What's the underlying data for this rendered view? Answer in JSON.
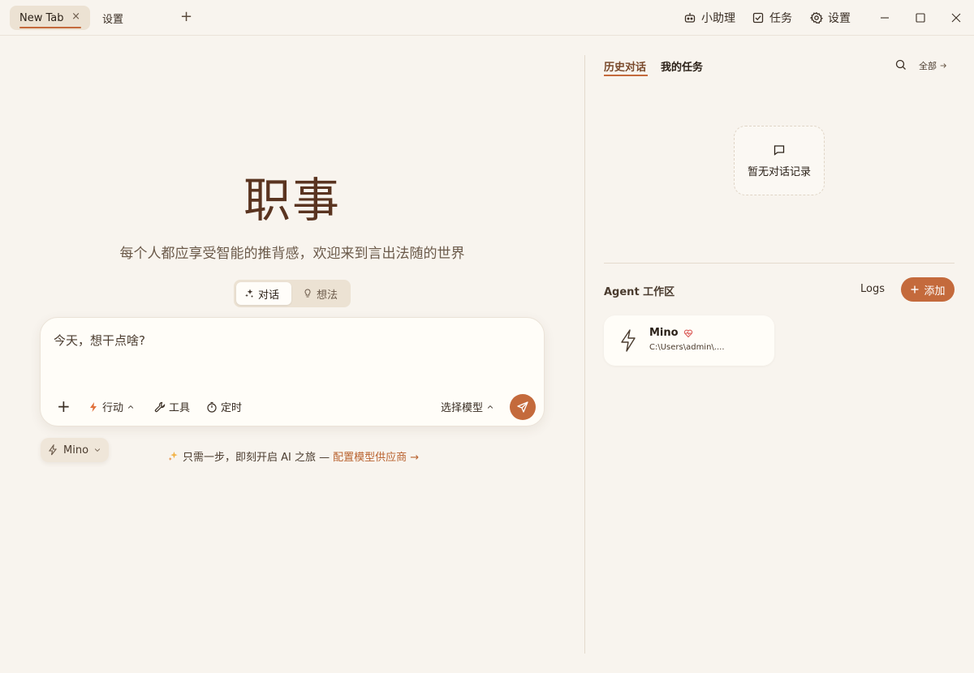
{
  "tabs": [
    {
      "label": "New Tab",
      "active": true,
      "close": "×"
    },
    {
      "label": "设置",
      "active": false
    }
  ],
  "new_tab_symbol": "+",
  "titlebar_actions": [
    {
      "label": "小助理",
      "icon": "robot-icon"
    },
    {
      "label": "任务",
      "icon": "checkbox-icon"
    },
    {
      "label": "设置",
      "icon": "gear-icon"
    }
  ],
  "window_controls": [
    "minimize",
    "maximize",
    "close"
  ],
  "main": {
    "brand": "职事",
    "tagline": "每个人都应享受智能的推背感，欢迎来到言出法随的世界",
    "modes": [
      {
        "label": "对话",
        "icon": "sparkle-icon",
        "selected": true
      },
      {
        "label": "想法",
        "icon": "lightbulb-icon",
        "selected": false
      }
    ],
    "composer": {
      "placeholder": "今天，想干点啥?",
      "add_symbol": "+",
      "action_label": "行动",
      "tools_label": "工具",
      "schedule_label": "定时",
      "model_label": "选择模型"
    },
    "agent_pill": {
      "label": "Mino"
    },
    "setup_hint": {
      "text": "只需一步，即刻开启 AI 之旅 —",
      "link": "配置模型供应商 →"
    }
  },
  "right_panel": {
    "tabs": [
      {
        "label": "历史对话",
        "active": true
      },
      {
        "label": "我的任务",
        "active": false
      }
    ],
    "all_label": "全部",
    "empty_text": "暂无对话记录",
    "workspace": {
      "title": "Agent 工作区",
      "logs_label": "Logs",
      "add_label": "添加",
      "agents": [
        {
          "name": "Mino",
          "path": "C:\\Users\\admin\\...."
        }
      ]
    }
  },
  "colors": {
    "background": "#f8f4ee",
    "accent": "#c46a3c",
    "brand_text": "#5a3420",
    "panel_card": "#fffdf8"
  }
}
